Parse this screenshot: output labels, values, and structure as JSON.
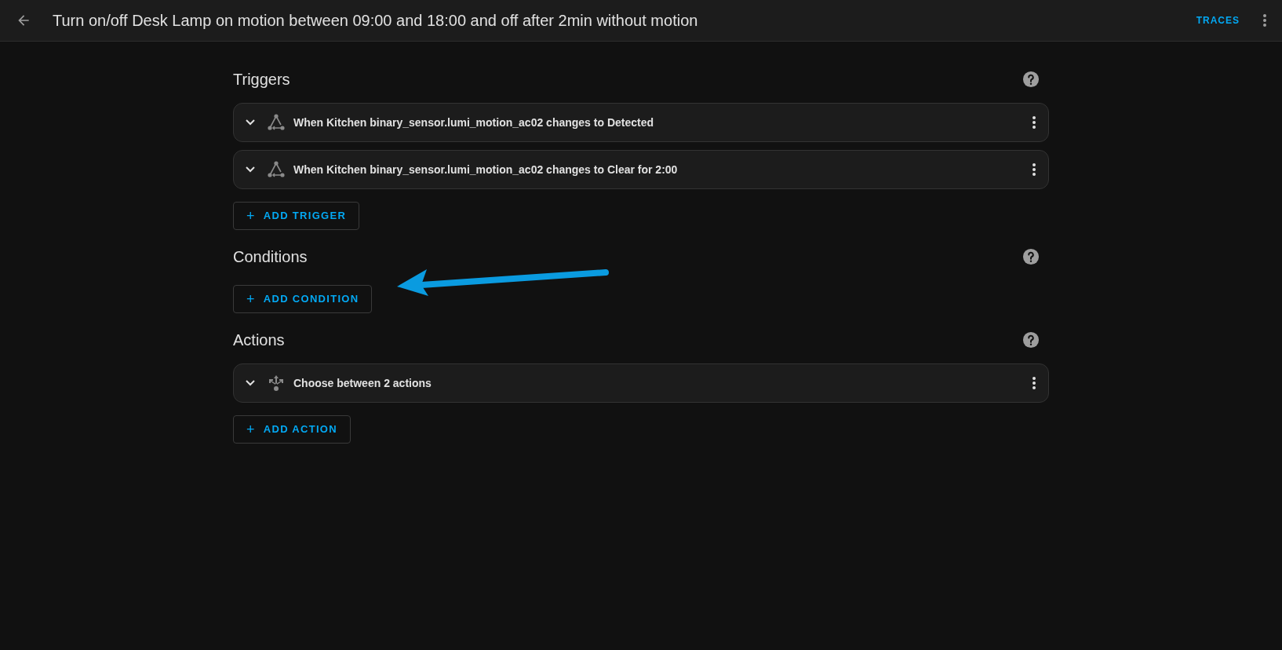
{
  "header": {
    "title": "Turn on/off Desk Lamp on motion between 09:00 and 18:00 and off after 2min without motion",
    "traces": "TRACES"
  },
  "sections": [
    {
      "title": "Triggers",
      "cards": [
        {
          "kind": "state",
          "label": "When Kitchen binary_sensor.lumi_motion_ac02 changes to Detected"
        },
        {
          "kind": "state",
          "label": "When Kitchen binary_sensor.lumi_motion_ac02 changes to Clear for 2:00"
        }
      ],
      "button": "ADD TRIGGER",
      "plus": "+"
    },
    {
      "title": "Conditions",
      "button": "ADD CONDITION",
      "plus": "+"
    },
    {
      "title": "Actions",
      "cards": [
        {
          "kind": "choose",
          "label": "Choose between 2 actions"
        }
      ],
      "button": "ADD ACTION",
      "plus": "+"
    }
  ]
}
